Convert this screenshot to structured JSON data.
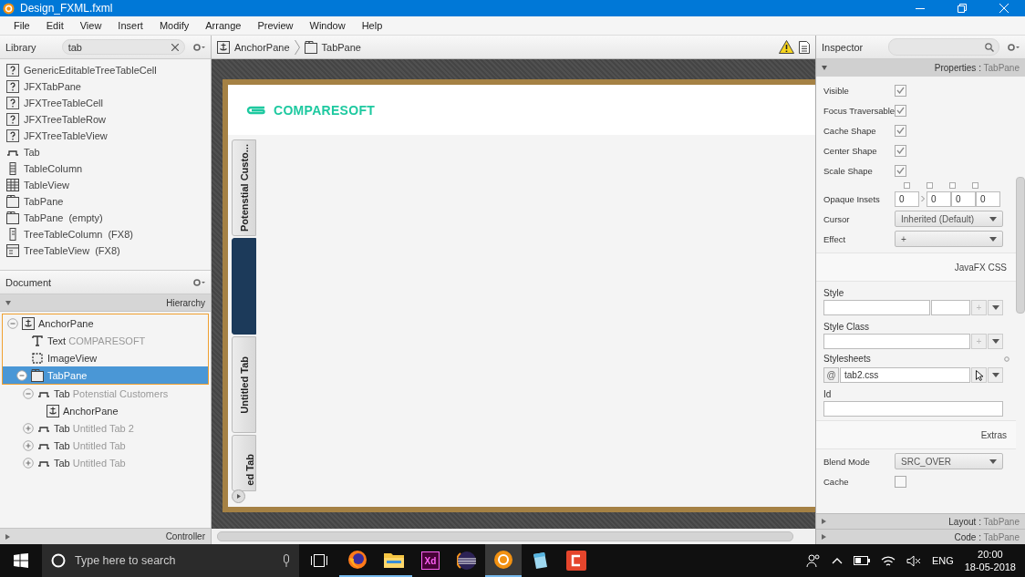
{
  "window": {
    "title": "Design_FXML.fxml"
  },
  "menu": [
    "File",
    "Edit",
    "View",
    "Insert",
    "Modify",
    "Arrange",
    "Preview",
    "Window",
    "Help"
  ],
  "library": {
    "title": "Library",
    "search": "tab",
    "items": [
      {
        "kind": "unknown",
        "label": "GenericEditableTreeTableCell"
      },
      {
        "kind": "unknown",
        "label": "JFXTabPane"
      },
      {
        "kind": "unknown",
        "label": "JFXTreeTableCell"
      },
      {
        "kind": "unknown",
        "label": "JFXTreeTableRow"
      },
      {
        "kind": "unknown",
        "label": "JFXTreeTableView"
      },
      {
        "kind": "tab",
        "label": "Tab"
      },
      {
        "kind": "column",
        "label": "TableColumn"
      },
      {
        "kind": "table",
        "label": "TableView"
      },
      {
        "kind": "tabpane",
        "label": "TabPane"
      },
      {
        "kind": "tabpane",
        "label": "TabPane",
        "note": "(empty)"
      },
      {
        "kind": "treecolumn",
        "label": "TreeTableColumn",
        "note": "(FX8)"
      },
      {
        "kind": "treetable",
        "label": "TreeTableView",
        "note": "(FX8)"
      }
    ]
  },
  "document": {
    "title": "Document",
    "section": "Hierarchy",
    "footer": "Controller",
    "tree": [
      {
        "kind": "anchor",
        "type": "AnchorPane",
        "expanded": true,
        "selected": false,
        "outlined": true,
        "children": [
          {
            "kind": "text",
            "type": "Text",
            "name": "COMPARESOFT",
            "selected": false,
            "outlined": true
          },
          {
            "kind": "image",
            "type": "ImageView",
            "selected": false,
            "outlined": true
          },
          {
            "kind": "tabpane",
            "type": "TabPane",
            "expanded": true,
            "selected": true,
            "outlined": true,
            "children": [
              {
                "kind": "tab",
                "type": "Tab",
                "name": "Potenstial Customers",
                "expanded": true,
                "selected": false,
                "outlined": false,
                "children": [
                  {
                    "kind": "anchor",
                    "type": "AnchorPane",
                    "selected": false,
                    "outlined": false
                  }
                ]
              },
              {
                "kind": "tab",
                "type": "Tab",
                "name": "Untitled Tab 2",
                "expanded": false,
                "selected": false,
                "outlined": false
              },
              {
                "kind": "tab",
                "type": "Tab",
                "name": "Untitled Tab",
                "expanded": false,
                "selected": false,
                "outlined": false
              },
              {
                "kind": "tab",
                "type": "Tab",
                "name": "Untitled Tab",
                "expanded": false,
                "selected": false,
                "outlined": false
              }
            ]
          }
        ]
      }
    ]
  },
  "breadcrumb": [
    {
      "kind": "anchor",
      "label": "AnchorPane"
    },
    {
      "kind": "tabpane",
      "label": "TabPane"
    }
  ],
  "canvas": {
    "brand": "COMPARESOFT",
    "tabs": [
      {
        "label": "Potenstial Custo...",
        "selected": false
      },
      {
        "selected": true
      },
      {
        "label": "Untitled Tab",
        "selected": false
      },
      {
        "label": "ed Tab",
        "selected": false
      }
    ]
  },
  "inspector": {
    "title": "Inspector",
    "section": "Properties",
    "separator": ":",
    "target": "TabPane",
    "properties": [
      {
        "kind": "checkbox",
        "label": "Visible",
        "checked": true
      },
      {
        "kind": "checkbox",
        "label": "Focus Traversable",
        "checked": true
      },
      {
        "kind": "checkbox",
        "label": "Cache Shape",
        "checked": true
      },
      {
        "kind": "checkbox",
        "label": "Center Shape",
        "checked": true
      },
      {
        "kind": "checkbox",
        "label": "Scale Shape",
        "checked": true
      },
      {
        "kind": "insets",
        "label": "Opaque Insets",
        "values": [
          "0",
          "0",
          "0",
          "0"
        ]
      },
      {
        "kind": "select",
        "label": "Cursor",
        "value": "Inherited (Default)"
      },
      {
        "kind": "select",
        "label": "Effect",
        "value": "+"
      }
    ],
    "css": {
      "heading": "JavaFX CSS",
      "style_label": "Style",
      "style_add": "+",
      "style_class_label": "Style Class",
      "style_class_add": "+",
      "stylesheets_label": "Stylesheets",
      "stylesheet_prefix": "@",
      "stylesheet": "tab2.css",
      "id_label": "Id"
    },
    "extras": {
      "heading": "Extras",
      "blend_mode_label": "Blend Mode",
      "blend_mode": "SRC_OVER",
      "cache_label": "Cache",
      "cache": false
    },
    "footers": [
      {
        "name": "Layout",
        "separator": ":",
        "target": "TabPane"
      },
      {
        "name": "Code",
        "separator": ":",
        "target": "TabPane"
      }
    ]
  },
  "taskbar": {
    "search_placeholder": "Type here to search",
    "apps": [
      {
        "kind": "firefox",
        "running": true,
        "selected": false
      },
      {
        "kind": "folder",
        "running": true,
        "selected": false
      },
      {
        "kind": "xd",
        "label": "Xd",
        "running": false,
        "selected": false
      },
      {
        "kind": "eclipse",
        "running": false,
        "selected": false
      },
      {
        "kind": "scenebuilder",
        "running": true,
        "selected": true
      },
      {
        "kind": "notepad",
        "running": false,
        "selected": false
      },
      {
        "kind": "camtasia",
        "running": false,
        "selected": false
      }
    ],
    "language": "ENG",
    "time": "20:00",
    "date": "18-05-2018"
  }
}
